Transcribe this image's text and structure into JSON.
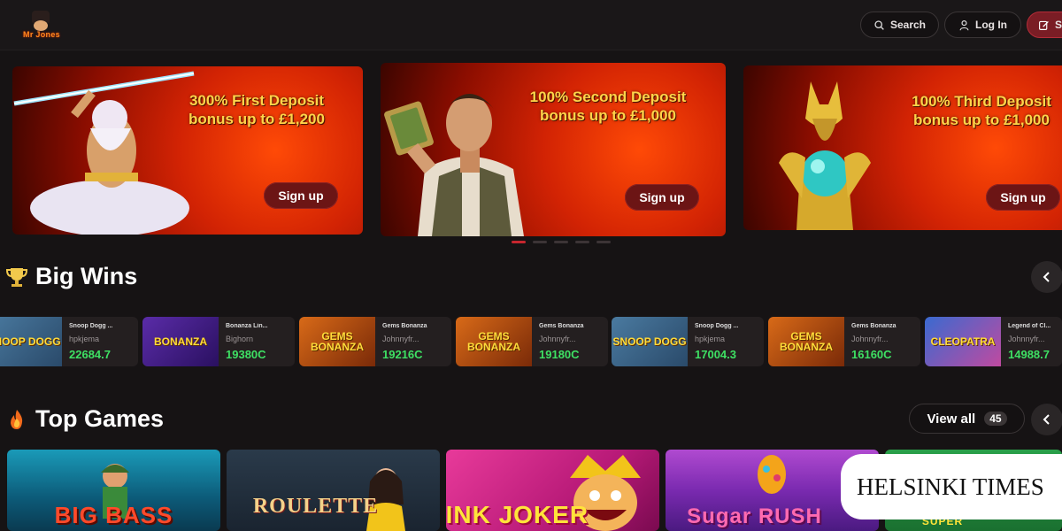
{
  "brand": {
    "logo_text": "Mr Jones"
  },
  "header": {
    "search_label": "Search",
    "login_label": "Log In",
    "signup_label": "S"
  },
  "banners": [
    {
      "line1": "300% First Deposit",
      "line2": "bonus up to £1,200",
      "cta": "Sign up"
    },
    {
      "line1": "100% Second Deposit",
      "line2": "bonus up to £1,000",
      "cta": "Sign up"
    },
    {
      "line1": "100% Third Deposit",
      "line2": "bonus up to £1,000",
      "cta": "Sign up"
    }
  ],
  "big_wins": {
    "title": "Big Wins",
    "items": [
      {
        "thumb": "SNOOP DOGG",
        "game": "Snoop Dogg ...",
        "player": "hpkjema",
        "amount": "22684.7"
      },
      {
        "thumb": "BONANZA",
        "game": "Bonanza Lin...",
        "player": "Bighorn",
        "amount": "19380C"
      },
      {
        "thumb": "GEMS BONANZA",
        "game": "Gems Bonanza",
        "player": "Johnnyfr...",
        "amount": "19216C"
      },
      {
        "thumb": "GEMS BONANZA",
        "game": "Gems Bonanza",
        "player": "Johnnyfr...",
        "amount": "19180C"
      },
      {
        "thumb": "SNOOP DOGG",
        "game": "Snoop Dogg ...",
        "player": "hpkjema",
        "amount": "17004.3"
      },
      {
        "thumb": "GEMS BONANZA",
        "game": "Gems Bonanza",
        "player": "Johnnyfr...",
        "amount": "16160C"
      },
      {
        "thumb": "CLEOPATRA",
        "game": "Legend of Cl...",
        "player": "Johnnyfr...",
        "amount": "14988.7"
      }
    ]
  },
  "top_games": {
    "title": "Top Games",
    "view_all_label": "View all",
    "view_all_count": "45",
    "items": [
      {
        "title": "BIG BASS"
      },
      {
        "title": "ROULETTE"
      },
      {
        "title": "PINK JOKER"
      },
      {
        "title": "Sugar RUSH"
      },
      {
        "title": "SUPER"
      }
    ]
  },
  "watermark": "HELSINKI TIMES",
  "colors": {
    "background": "#161314",
    "accent": "#c7262e",
    "win_amount": "#3ee063",
    "banner_text": "#ffd44a"
  },
  "icons": {
    "search": "search-icon",
    "login": "user-icon",
    "signup": "edit-icon",
    "big_wins": "trophy-icon",
    "top_games": "fire-icon",
    "arrows": "chevron-left-icon"
  }
}
